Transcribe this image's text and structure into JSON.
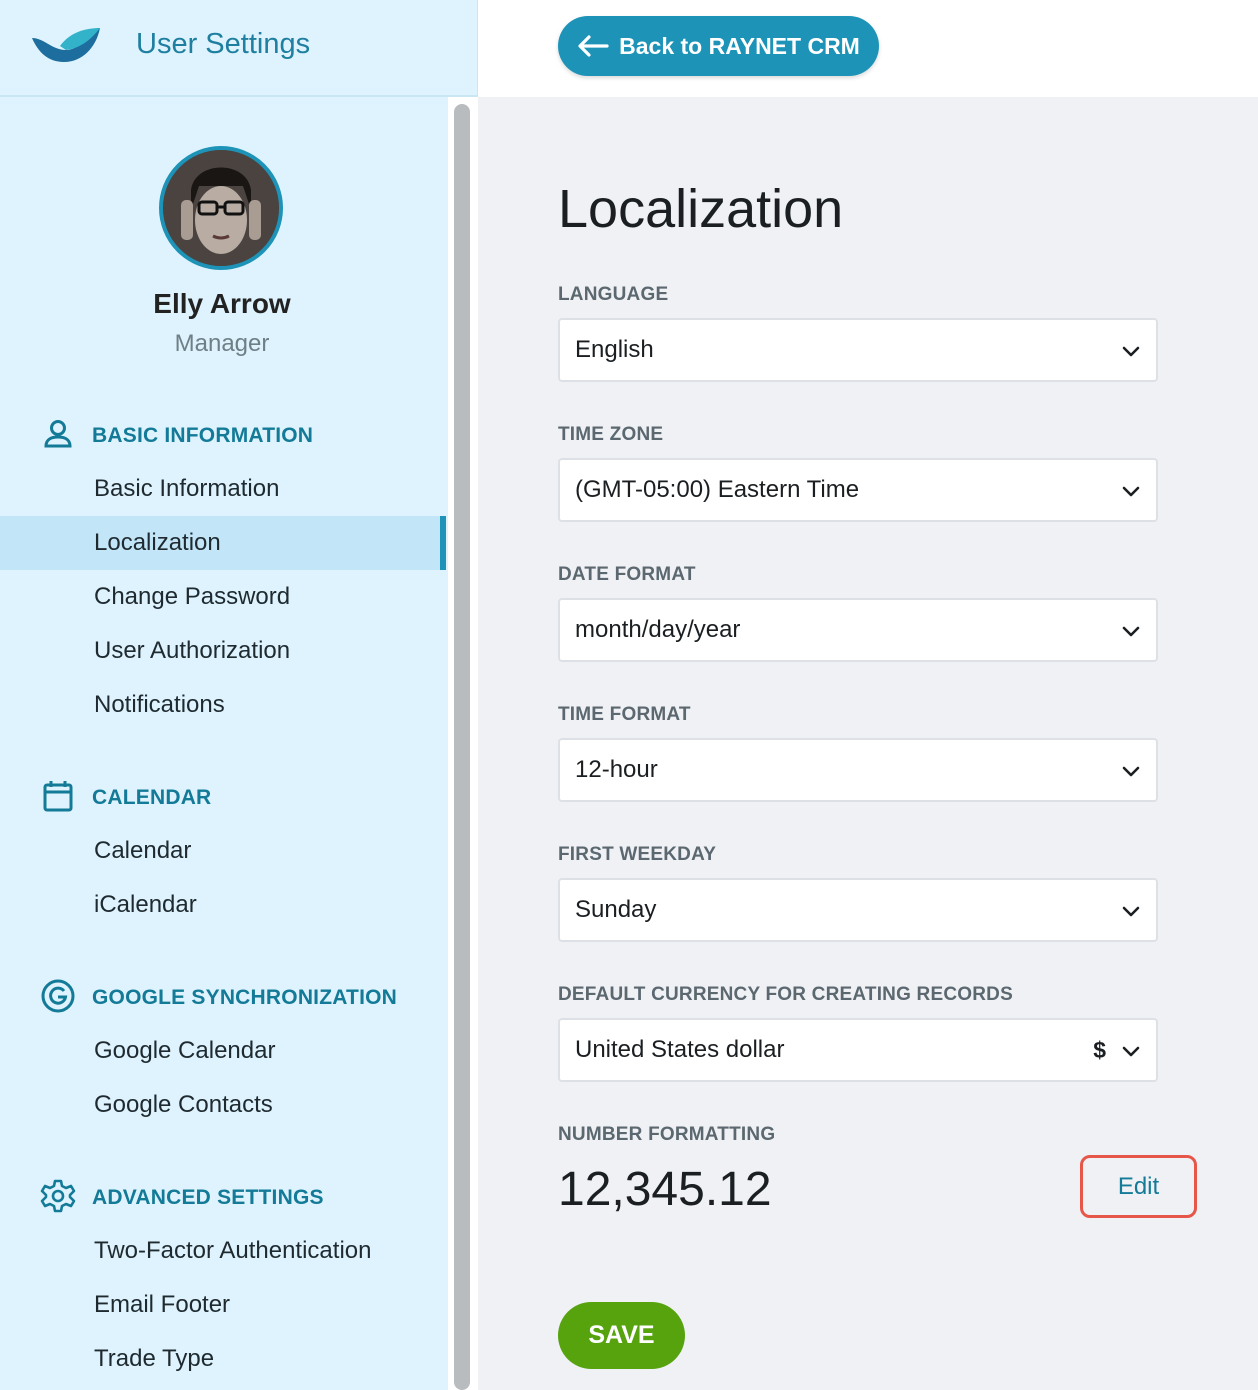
{
  "app": {
    "title": "User Settings",
    "back_button": "Back to RAYNET CRM"
  },
  "user": {
    "name": "Elly Arrow",
    "role": "Manager"
  },
  "sidebar": {
    "sections": [
      {
        "title": "BASIC INFORMATION",
        "icon": "user-icon",
        "items": [
          "Basic Information",
          "Localization",
          "Change Password",
          "User Authorization",
          "Notifications"
        ]
      },
      {
        "title": "CALENDAR",
        "icon": "calendar-icon",
        "items": [
          "Calendar",
          "iCalendar"
        ]
      },
      {
        "title": "GOOGLE SYNCHRONIZATION",
        "icon": "google-icon",
        "items": [
          "Google Calendar",
          "Google Contacts"
        ]
      },
      {
        "title": "ADVANCED SETTINGS",
        "icon": "gear-icon",
        "items": [
          "Two-Factor Authentication",
          "Email Footer",
          "Trade Type"
        ]
      }
    ],
    "active_item": "Localization"
  },
  "main": {
    "title": "Localization",
    "fields": {
      "language": {
        "label": "LANGUAGE",
        "value": "English"
      },
      "time_zone": {
        "label": "TIME ZONE",
        "value": "(GMT-05:00) Eastern Time"
      },
      "date_format": {
        "label": "DATE FORMAT",
        "value": "month/day/year"
      },
      "time_format": {
        "label": "TIME FORMAT",
        "value": "12-hour"
      },
      "first_weekday": {
        "label": "FIRST WEEKDAY",
        "value": "Sunday"
      },
      "currency": {
        "label": "DEFAULT CURRENCY FOR CREATING RECORDS",
        "value": "United States dollar",
        "symbol": "$"
      }
    },
    "number_formatting": {
      "label": "NUMBER FORMATTING",
      "value": "12,345.12",
      "edit_label": "Edit"
    },
    "save_label": "SAVE"
  },
  "colors": {
    "accent": "#1d93b8",
    "save": "#56a30e",
    "highlight_border": "#e6574a",
    "sidebar_bg": "#def3fd"
  }
}
